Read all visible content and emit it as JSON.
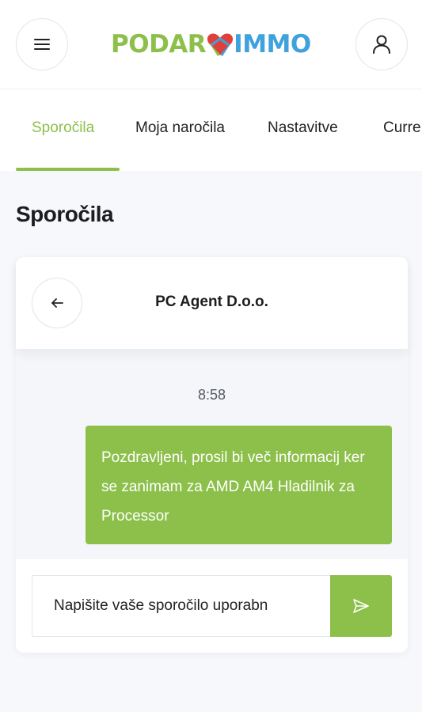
{
  "header": {
    "logo_part1": "PODAR",
    "logo_part2": "IMMO",
    "menu_icon": "hamburger-icon",
    "user_icon": "user-icon"
  },
  "tabs": [
    {
      "label": "Sporočila",
      "active": true
    },
    {
      "label": "Moja naročila",
      "active": false
    },
    {
      "label": "Nastavitve",
      "active": false
    },
    {
      "label": "Curre",
      "active": false
    }
  ],
  "page": {
    "title": "Sporočila"
  },
  "chat": {
    "contact_name": "PC Agent D.o.o.",
    "back_icon": "arrow-left-icon",
    "messages": [
      {
        "time": "8:58",
        "text": "Pozdravljeni, prosil bi več informacij ker se zanimam za AMD AM4 Hladilnik za Processor",
        "outgoing": true
      }
    ],
    "input_placeholder": "Napišite vaše sporočilo uporabn",
    "send_icon": "send-icon"
  },
  "colors": {
    "accent_green": "#8dc04a",
    "accent_blue": "#3fa2dc",
    "heart_red": "#e0403a",
    "background": "#f6f8fb"
  }
}
